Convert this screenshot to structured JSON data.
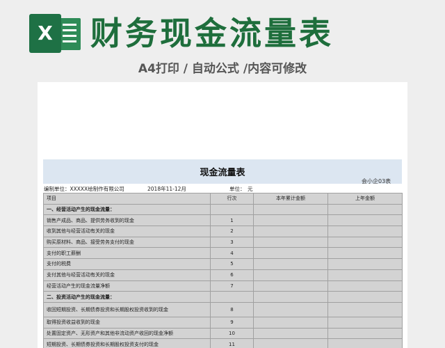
{
  "banner": {
    "logo_letter": "X",
    "title": "财务现金流量表",
    "subtitle": "A4打印 / 自动公式 /内容可修改",
    "colors": {
      "brand_green": "#1e6e3c",
      "logo_green": "#1e7145"
    }
  },
  "sheet": {
    "title": "现金流量表",
    "form_code": "会小企03表",
    "company_label": "编制单位：XXXXX绘制作有限公司",
    "period": "2018年11-12月",
    "unit_label": "单位：",
    "unit_value": "元",
    "columns": [
      "项目",
      "行次",
      "本年累计金额",
      "上年金额"
    ],
    "rows": [
      {
        "item": "一、经营活动产生的现金流量：",
        "line": "",
        "section": true,
        "tall": false
      },
      {
        "item": "销售产成品、商品、提供劳务收到的现金",
        "line": "1",
        "section": false,
        "tall": false
      },
      {
        "item": "收到其他与经营活动有关的现金",
        "line": "2",
        "section": false,
        "tall": false
      },
      {
        "item": "购买原材料、商品、接受劳务支付的现金",
        "line": "3",
        "section": false,
        "tall": false
      },
      {
        "item": "支付的职工薪酬",
        "line": "4",
        "section": false,
        "tall": false
      },
      {
        "item": "支付的税费",
        "line": "5",
        "section": false,
        "tall": false
      },
      {
        "item": "支付其他与经营活动有关的现金",
        "line": "6",
        "section": false,
        "tall": false
      },
      {
        "item": "  经营活动产生的现金流量净额",
        "line": "7",
        "section": false,
        "tall": false
      },
      {
        "item": "二、投资活动产生的现金流量：",
        "line": "",
        "section": true,
        "tall": false
      },
      {
        "item": "收回短期投资、长期债券投资和长期股权投资收到的现金",
        "line": "8",
        "section": false,
        "tall": true
      },
      {
        "item": "取得投资收益收到的现金",
        "line": "9",
        "section": false,
        "tall": false
      },
      {
        "item": "处置固定资产、无形资产和其他非流动资产收回的现金净额",
        "line": "10",
        "section": false,
        "tall": false
      },
      {
        "item": "短期投资、长期债券投资和长期股权投资支付的现金",
        "line": "11",
        "section": false,
        "tall": false
      }
    ]
  }
}
